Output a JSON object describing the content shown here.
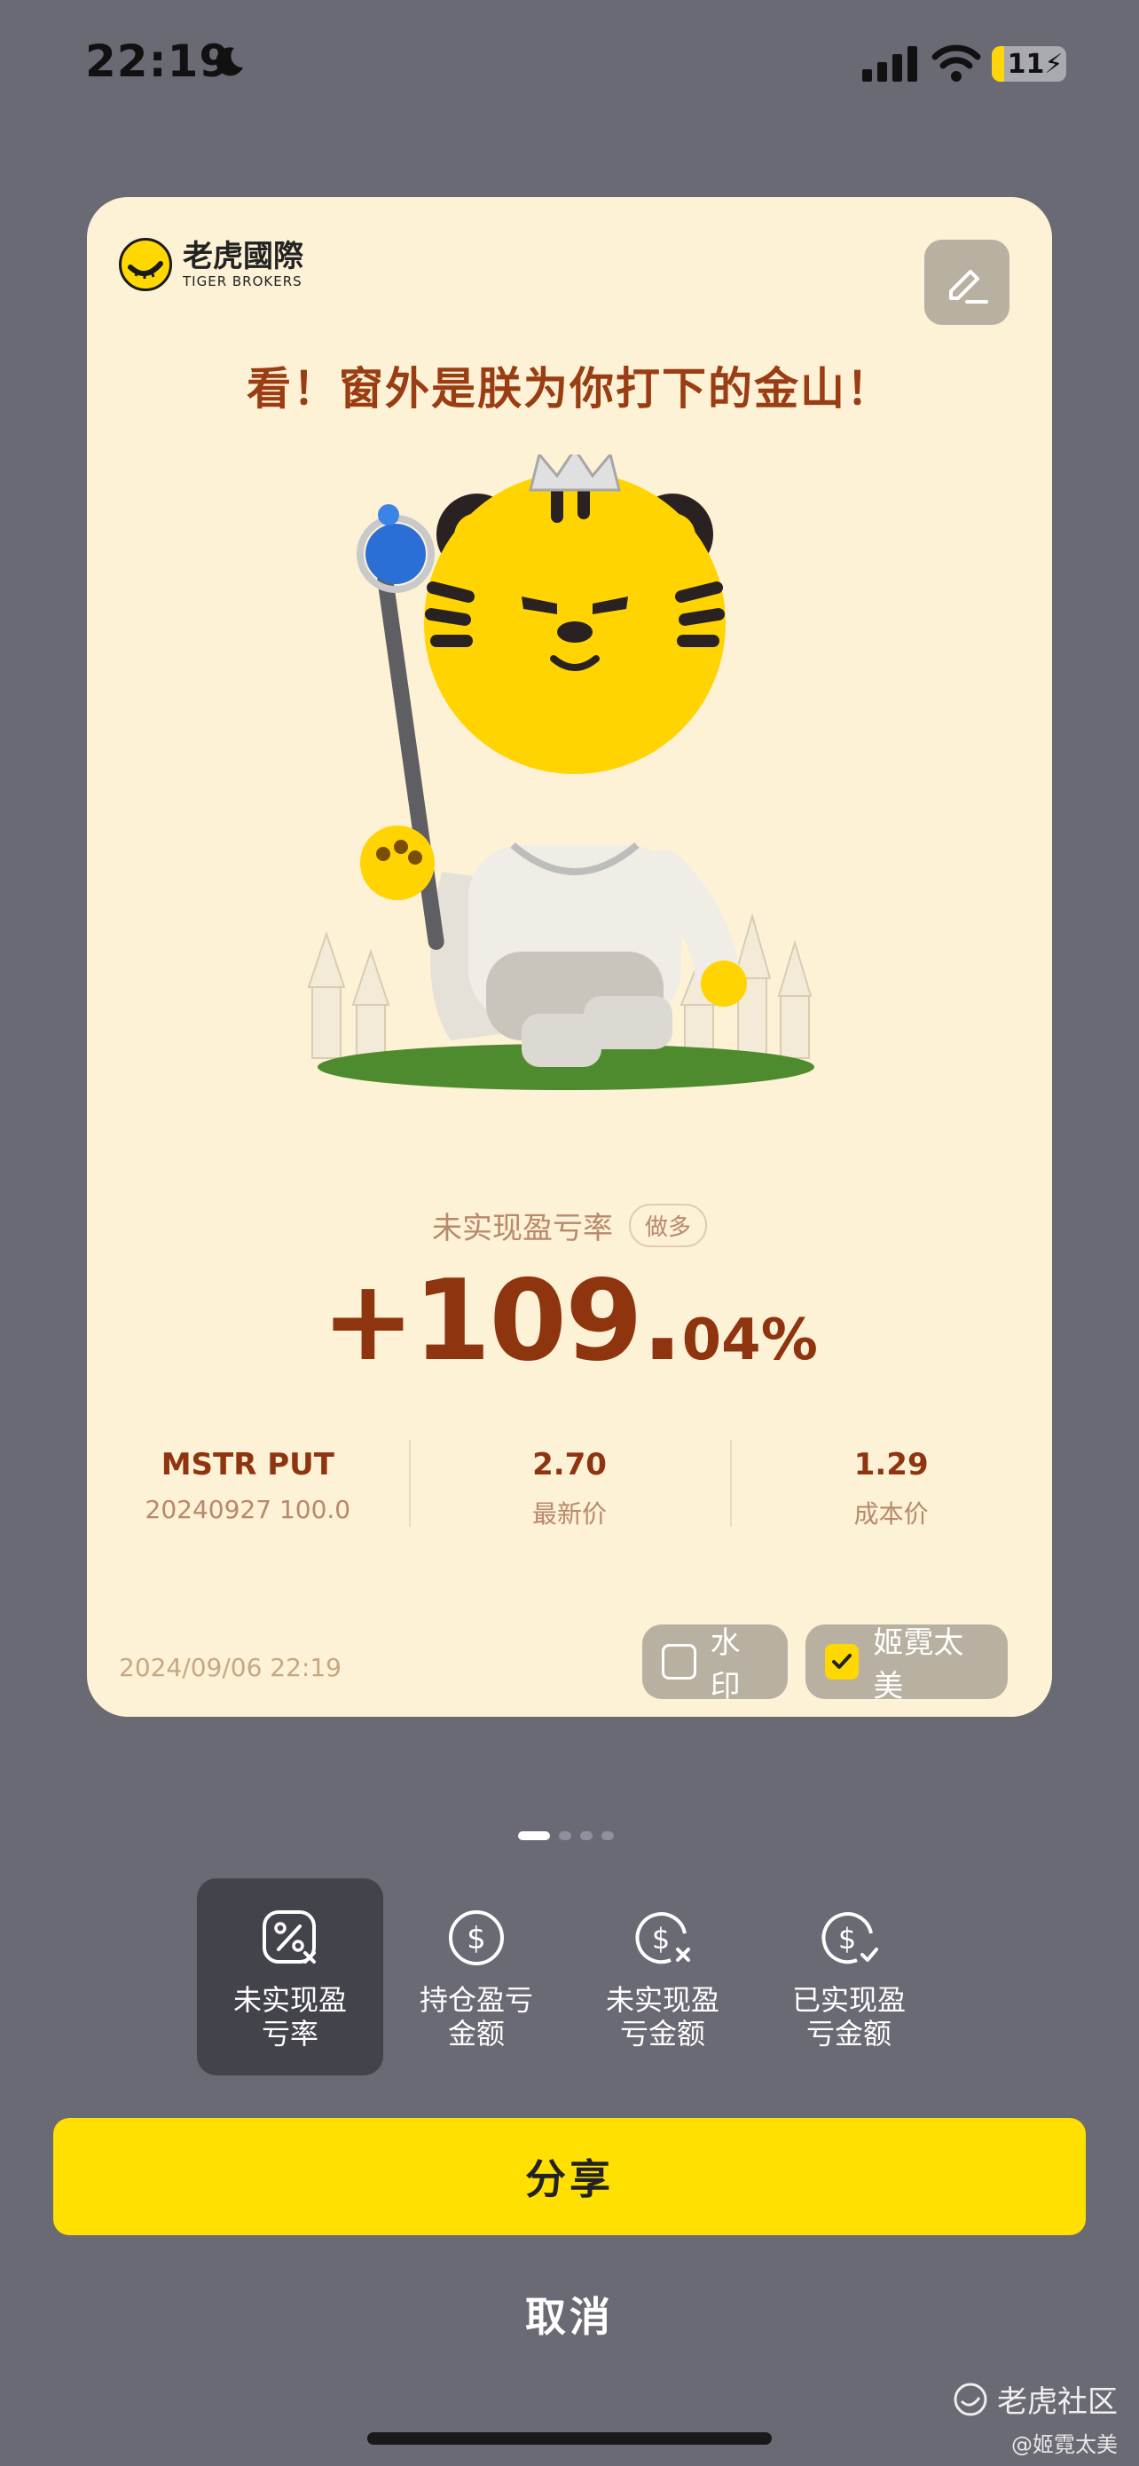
{
  "status_bar": {
    "time": "22:19",
    "battery": "11"
  },
  "card": {
    "logo_cn": "老虎國際",
    "logo_en": "TIGER BROKERS",
    "headline": "看！窗外是朕为你打下的金山！",
    "metric_label": "未实现盈亏率",
    "position_tag": "做多",
    "value_main": "+109.",
    "value_decimal": "04%",
    "info": [
      {
        "main": "MSTR PUT",
        "sub": "20240927  100.0"
      },
      {
        "main": "2.70",
        "sub": "最新价"
      },
      {
        "main": "1.29",
        "sub": "成本价"
      }
    ],
    "date": "2024/09/06 22:19",
    "watermark_label": "水印",
    "watermark_checked": false,
    "name_label": "姬霓太美",
    "name_checked": true
  },
  "pager": {
    "count": 4,
    "active": 0
  },
  "tabs": [
    {
      "label": "未实现盈亏率",
      "icon": "percent-icon",
      "active": true
    },
    {
      "label": "持仓盈亏金额",
      "icon": "dollar-icon",
      "active": false
    },
    {
      "label": "未实现盈亏金额",
      "icon": "dollar-x-icon",
      "active": false
    },
    {
      "label": "已实现盈亏金额",
      "icon": "dollar-check-icon",
      "active": false
    }
  ],
  "buttons": {
    "share": "分享",
    "cancel": "取消"
  },
  "watermark": {
    "brand": "老虎社区",
    "user": "@姬霓太美"
  },
  "colors": {
    "accent": "#ffe000",
    "card_bg": "#fdf1d6",
    "value": "#8e3510",
    "backdrop": "#6a6a74"
  }
}
